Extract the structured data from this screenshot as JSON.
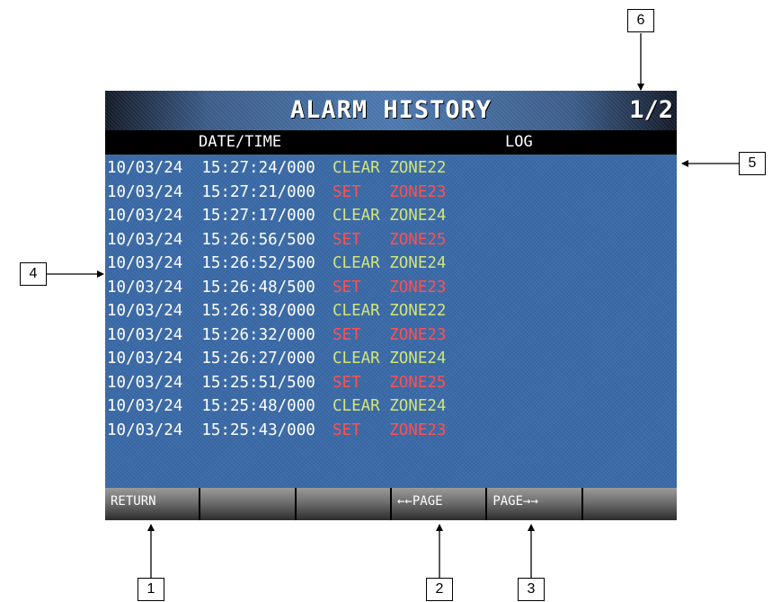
{
  "screen": {
    "title": "ALARM HISTORY",
    "page_indicator": "1/2",
    "headers": {
      "date_time": "DATE/TIME",
      "log": "LOG"
    },
    "rows": [
      {
        "datetime": "10/03/24  15:27:24/000",
        "log": "CLEAR ZONE22",
        "type": "clear"
      },
      {
        "datetime": "10/03/24  15:27:21/000",
        "log": "SET   ZONE23",
        "type": "set"
      },
      {
        "datetime": "10/03/24  15:27:17/000",
        "log": "CLEAR ZONE24",
        "type": "clear"
      },
      {
        "datetime": "10/03/24  15:26:56/500",
        "log": "SET   ZONE25",
        "type": "set"
      },
      {
        "datetime": "10/03/24  15:26:52/500",
        "log": "CLEAR ZONE24",
        "type": "clear"
      },
      {
        "datetime": "10/03/24  15:26:48/500",
        "log": "SET   ZONE23",
        "type": "set"
      },
      {
        "datetime": "10/03/24  15:26:38/000",
        "log": "CLEAR ZONE22",
        "type": "clear"
      },
      {
        "datetime": "10/03/24  15:26:32/000",
        "log": "SET   ZONE23",
        "type": "set"
      },
      {
        "datetime": "10/03/24  15:26:27/000",
        "log": "CLEAR ZONE24",
        "type": "clear"
      },
      {
        "datetime": "10/03/24  15:25:51/500",
        "log": "SET   ZONE25",
        "type": "set"
      },
      {
        "datetime": "10/03/24  15:25:48/000",
        "log": "CLEAR ZONE24",
        "type": "clear"
      },
      {
        "datetime": "10/03/24  15:25:43/000",
        "log": "SET   ZONE23",
        "type": "set"
      }
    ],
    "function_keys": [
      "RETURN",
      "",
      "",
      "←←PAGE",
      "PAGE→→",
      ""
    ]
  },
  "callouts": [
    "1",
    "2",
    "3",
    "4",
    "5",
    "6"
  ],
  "colors": {
    "screen_bg": "#3a6aa8",
    "clear_text": "#d2e678",
    "set_text": "#ff5050",
    "header_bg": "#000000"
  }
}
